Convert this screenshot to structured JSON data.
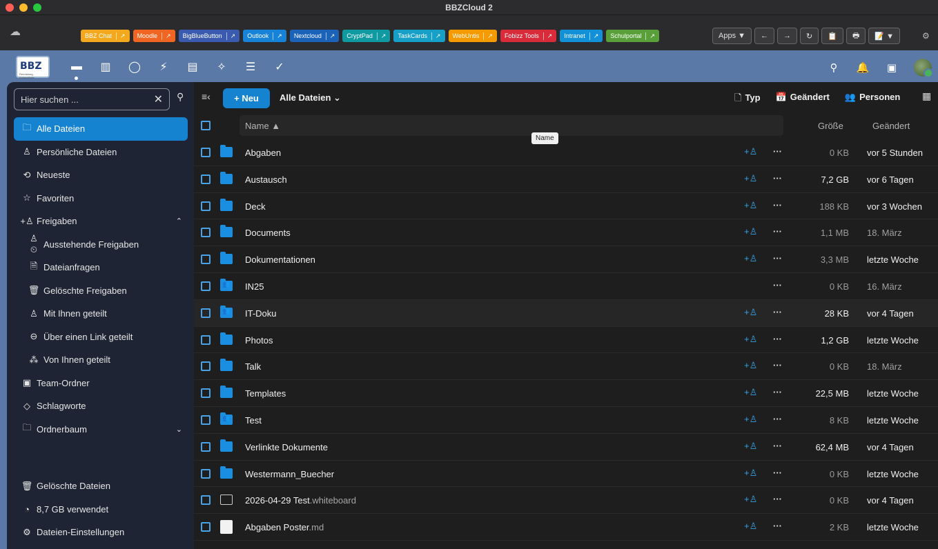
{
  "window": {
    "title": "BBZCloud 2"
  },
  "traffic_colors": [
    "#ff5f57",
    "#febc2e",
    "#28c840"
  ],
  "quicklinks": [
    {
      "label": "BBZ Chat",
      "color": "#f4a81d"
    },
    {
      "label": "Moodle",
      "color": "#f06522"
    },
    {
      "label": "BigBlueButton",
      "color": "#3b5bb0"
    },
    {
      "label": "Outlook",
      "color": "#1683d8"
    },
    {
      "label": "Nextcloud",
      "color": "#1a63b8"
    },
    {
      "label": "CryptPad",
      "color": "#0f9aa1"
    },
    {
      "label": "TaskCards",
      "color": "#16a0c8"
    },
    {
      "label": "WebUntis",
      "color": "#f59b00"
    },
    {
      "label": "Fobizz Tools",
      "color": "#d92b3a"
    },
    {
      "label": "Intranet",
      "color": "#1291d8"
    },
    {
      "label": "Schulportal",
      "color": "#5aa03a"
    }
  ],
  "toolbar": {
    "apps_label": "Apps ▼",
    "back": "←",
    "forward": "→",
    "reload": "↻",
    "clip": "📋",
    "print": "🖶",
    "note": "📝 ▼"
  },
  "logo": {
    "text": "BBZ",
    "subtitle": "Rendsburg-Eckernförde"
  },
  "sidebar": {
    "search_placeholder": "Hier suchen ...",
    "items": [
      {
        "label": "Alle Dateien",
        "icon": "folder-icon"
      },
      {
        "label": "Persönliche Dateien",
        "icon": "user-icon"
      },
      {
        "label": "Neueste",
        "icon": "history-icon"
      },
      {
        "label": "Favoriten",
        "icon": "star-icon"
      },
      {
        "label": "Freigaben",
        "icon": "share-icon"
      },
      {
        "label": "Ausstehende Freigaben",
        "icon": "pending-icon"
      },
      {
        "label": "Dateianfragen",
        "icon": "file-request-icon"
      },
      {
        "label": "Gelöschte Freigaben",
        "icon": "trash-icon"
      },
      {
        "label": "Mit Ihnen geteilt",
        "icon": "user-icon"
      },
      {
        "label": "Über einen Link geteilt",
        "icon": "link-icon"
      },
      {
        "label": "Von Ihnen geteilt",
        "icon": "group-icon"
      },
      {
        "label": "Team-Ordner",
        "icon": "team-folder-icon"
      },
      {
        "label": "Schlagworte",
        "icon": "tag-icon"
      },
      {
        "label": "Ordnerbaum",
        "icon": "folder-tree-icon"
      }
    ],
    "bottom": [
      {
        "label": "Gelöschte Dateien",
        "icon": "trash-icon"
      },
      {
        "label": "8,7 GB verwendet",
        "icon": "pie-icon"
      },
      {
        "label": "Dateien-Einstellungen",
        "icon": "gear-icon"
      }
    ]
  },
  "main": {
    "new_label": "+ Neu",
    "breadcrumb": "Alle Dateien",
    "filters": {
      "type": "Typ",
      "modified": "Geändert",
      "people": "Personen"
    },
    "columns": {
      "name": "Name ▲",
      "size": "Größe",
      "modified": "Geändert"
    },
    "tooltip": "Name",
    "files": [
      {
        "name": "Abgaben",
        "ext": "",
        "kind": "folder",
        "size": "0 KB",
        "modified": "vor 5 Stunden",
        "share": true
      },
      {
        "name": "Austausch",
        "ext": "",
        "kind": "folder",
        "size": "7,2 GB",
        "modified": "vor 6 Tagen",
        "share": true
      },
      {
        "name": "Deck",
        "ext": "",
        "kind": "folder",
        "size": "188 KB",
        "modified": "vor 3 Wochen",
        "share": true
      },
      {
        "name": "Documents",
        "ext": "",
        "kind": "folder",
        "size": "1,1 MB",
        "modified": "18. März",
        "share": true
      },
      {
        "name": "Dokumentationen",
        "ext": "",
        "kind": "folder",
        "size": "3,3 MB",
        "modified": "letzte Woche",
        "share": true
      },
      {
        "name": "IN25",
        "ext": "",
        "kind": "team",
        "size": "0 KB",
        "modified": "16. März",
        "share": false
      },
      {
        "name": "IT-Doku",
        "ext": "",
        "kind": "team",
        "size": "28 KB",
        "modified": "vor 4 Tagen",
        "share": true
      },
      {
        "name": "Photos",
        "ext": "",
        "kind": "folder",
        "size": "1,2 GB",
        "modified": "letzte Woche",
        "share": true
      },
      {
        "name": "Talk",
        "ext": "",
        "kind": "folder",
        "size": "0 KB",
        "modified": "18. März",
        "share": true
      },
      {
        "name": "Templates",
        "ext": "",
        "kind": "folder",
        "size": "22,5 MB",
        "modified": "letzte Woche",
        "share": true
      },
      {
        "name": "Test",
        "ext": "",
        "kind": "team",
        "size": "8 KB",
        "modified": "letzte Woche",
        "share": true
      },
      {
        "name": "Verlinkte Dokumente",
        "ext": "",
        "kind": "folder",
        "size": "62,4 MB",
        "modified": "vor 4 Tagen",
        "share": true
      },
      {
        "name": "Westermann_Buecher",
        "ext": "",
        "kind": "folder",
        "size": "0 KB",
        "modified": "letzte Woche",
        "share": true
      },
      {
        "name": "2026-04-29 Test",
        "ext": ".whiteboard",
        "kind": "whiteboard",
        "size": "0 KB",
        "modified": "vor 4 Tagen",
        "share": true
      },
      {
        "name": "Abgaben Poster",
        "ext": ".md",
        "kind": "md",
        "size": "2 KB",
        "modified": "letzte Woche",
        "share": true
      }
    ]
  }
}
